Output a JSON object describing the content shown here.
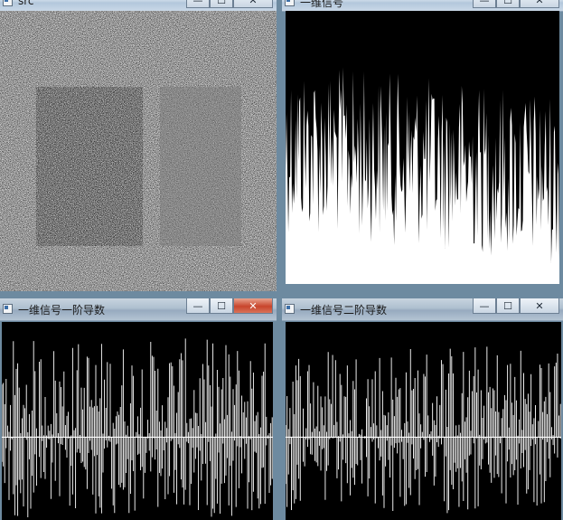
{
  "windows": {
    "src": {
      "title": "src"
    },
    "signal": {
      "title": "一维信号"
    },
    "first_derivative": {
      "title": "一维信号一阶导数"
    },
    "second_derivative": {
      "title": "一维信号二阶导数"
    }
  },
  "buttons": {
    "minimize": "—",
    "maximize": "☐",
    "close": "✕"
  },
  "icons": {
    "window": "window-icon",
    "minimize": "minimize-icon",
    "maximize": "maximize-icon",
    "close": "close-icon"
  },
  "colors": {
    "titlebar": "#c6d6e6",
    "close_active": "#c8452c",
    "plot_bg": "#000000",
    "plot_fg": "#ffffff"
  }
}
